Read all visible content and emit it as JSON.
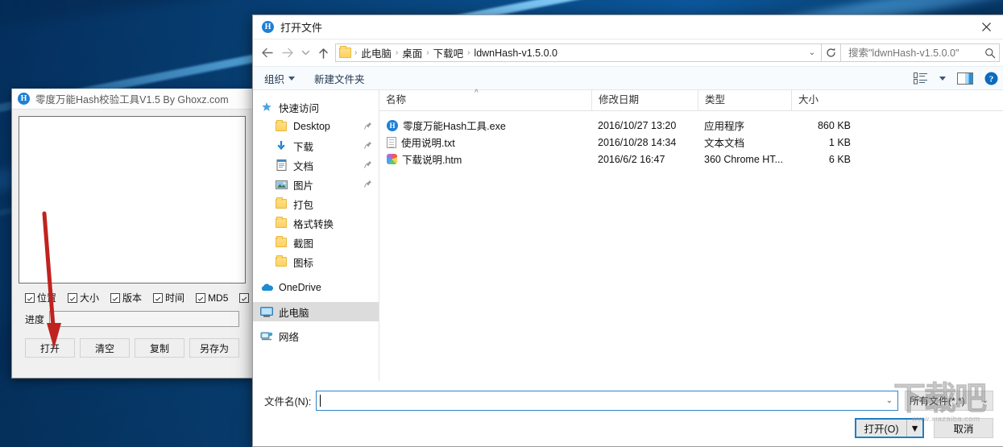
{
  "desktop": {
    "wallpaper_name": "windows-10-hero-wallpaper"
  },
  "hash_tool": {
    "title": "零度万能Hash校验工具V1.5 By Ghoxz.com",
    "app_icon": "hash-app-icon",
    "text_area_value": "",
    "checkboxes": [
      {
        "label": "位置",
        "checked": true
      },
      {
        "label": "大小",
        "checked": true
      },
      {
        "label": "版本",
        "checked": true
      },
      {
        "label": "时间",
        "checked": true
      },
      {
        "label": "MD5",
        "checked": true
      },
      {
        "label": "",
        "checked": true
      }
    ],
    "progress_label": "进度",
    "progress_value": "",
    "buttons": [
      {
        "label": "打开",
        "name": "open"
      },
      {
        "label": "清空",
        "name": "clear"
      },
      {
        "label": "复制",
        "name": "copy"
      },
      {
        "label": "另存为",
        "name": "save-as"
      }
    ],
    "annotation": {
      "type": "red-arrow",
      "points_to": "打开",
      "color": "#c0231f"
    }
  },
  "dialog": {
    "title": "打开文件",
    "title_icon": "hash-app-icon",
    "close_label": "✕",
    "nav": {
      "back_label": "←",
      "forward_label": "→",
      "recent_label": "⌄",
      "up_label": "↑"
    },
    "breadcrumb": {
      "folder_icon": "folder-icon",
      "items": [
        "此电脑",
        "桌面",
        "下载吧",
        "ldwnHash-v1.5.0.0"
      ],
      "separator": "›",
      "dropdown_icon": "chevron-down-icon",
      "refresh_icon": "refresh-icon"
    },
    "search": {
      "placeholder": "搜索\"ldwnHash-v1.5.0.0\"",
      "value": "",
      "icon": "search-icon"
    },
    "toolbar": {
      "organize_label": "组织",
      "new_folder_label": "新建文件夹",
      "view_icon": "view-list-icon",
      "view_chevron": "chevron-down-icon",
      "preview_icon": "preview-pane-icon",
      "help_icon": "help-icon"
    },
    "navigation_pane": {
      "items": [
        {
          "label": "快速访问",
          "icon": "star-pin-icon",
          "indent": false,
          "pinned": false,
          "selected": false
        },
        {
          "label": "Desktop",
          "icon": "folder-icon",
          "indent": true,
          "pinned": true,
          "selected": false
        },
        {
          "label": "下载",
          "icon": "download-icon",
          "indent": true,
          "pinned": true,
          "selected": false
        },
        {
          "label": "文档",
          "icon": "documents-icon",
          "indent": true,
          "pinned": true,
          "selected": false
        },
        {
          "label": "图片",
          "icon": "pictures-icon",
          "indent": true,
          "pinned": true,
          "selected": false
        },
        {
          "label": "打包",
          "icon": "folder-icon",
          "indent": true,
          "pinned": false,
          "selected": false
        },
        {
          "label": "格式转换",
          "icon": "folder-icon",
          "indent": true,
          "pinned": false,
          "selected": false
        },
        {
          "label": "截图",
          "icon": "folder-icon",
          "indent": true,
          "pinned": false,
          "selected": false
        },
        {
          "label": "图标",
          "icon": "folder-icon",
          "indent": true,
          "pinned": false,
          "selected": false
        },
        {
          "label": "OneDrive",
          "icon": "onedrive-icon",
          "indent": false,
          "pinned": false,
          "selected": false
        },
        {
          "label": "此电脑",
          "icon": "this-pc-icon",
          "indent": false,
          "pinned": false,
          "selected": true
        },
        {
          "label": "网络",
          "icon": "network-icon",
          "indent": false,
          "pinned": false,
          "selected": false
        }
      ],
      "pin_glyph": "📌"
    },
    "file_list": {
      "columns": [
        "名称",
        "修改日期",
        "类型",
        "大小"
      ],
      "sort_column": "名称",
      "sort_direction": "asc",
      "sort_glyph": "^",
      "rows": [
        {
          "name": "零度万能Hash工具.exe",
          "date": "2016/10/27 13:20",
          "type": "应用程序",
          "size": "860 KB",
          "icon": "exe-hash-icon"
        },
        {
          "name": "使用说明.txt",
          "date": "2016/10/28 14:34",
          "type": "文本文档",
          "size": "1 KB",
          "icon": "text-file-icon"
        },
        {
          "name": "下载说明.htm",
          "date": "2016/6/2 16:47",
          "type": "360 Chrome HT...",
          "size": "6 KB",
          "icon": "html-file-icon"
        }
      ]
    },
    "footer": {
      "filename_label": "文件名(N):",
      "filename_value": "",
      "filename_chevron": "chevron-down-icon",
      "filter_value": "所有文件(*.*)",
      "filter_chevron": "chevron-down-icon",
      "open_label": "打开(O)",
      "open_split_glyph": "▼",
      "cancel_label": "取消"
    }
  },
  "watermark": {
    "big_text": "下载吧",
    "url": "www.xiazaiba.com"
  }
}
